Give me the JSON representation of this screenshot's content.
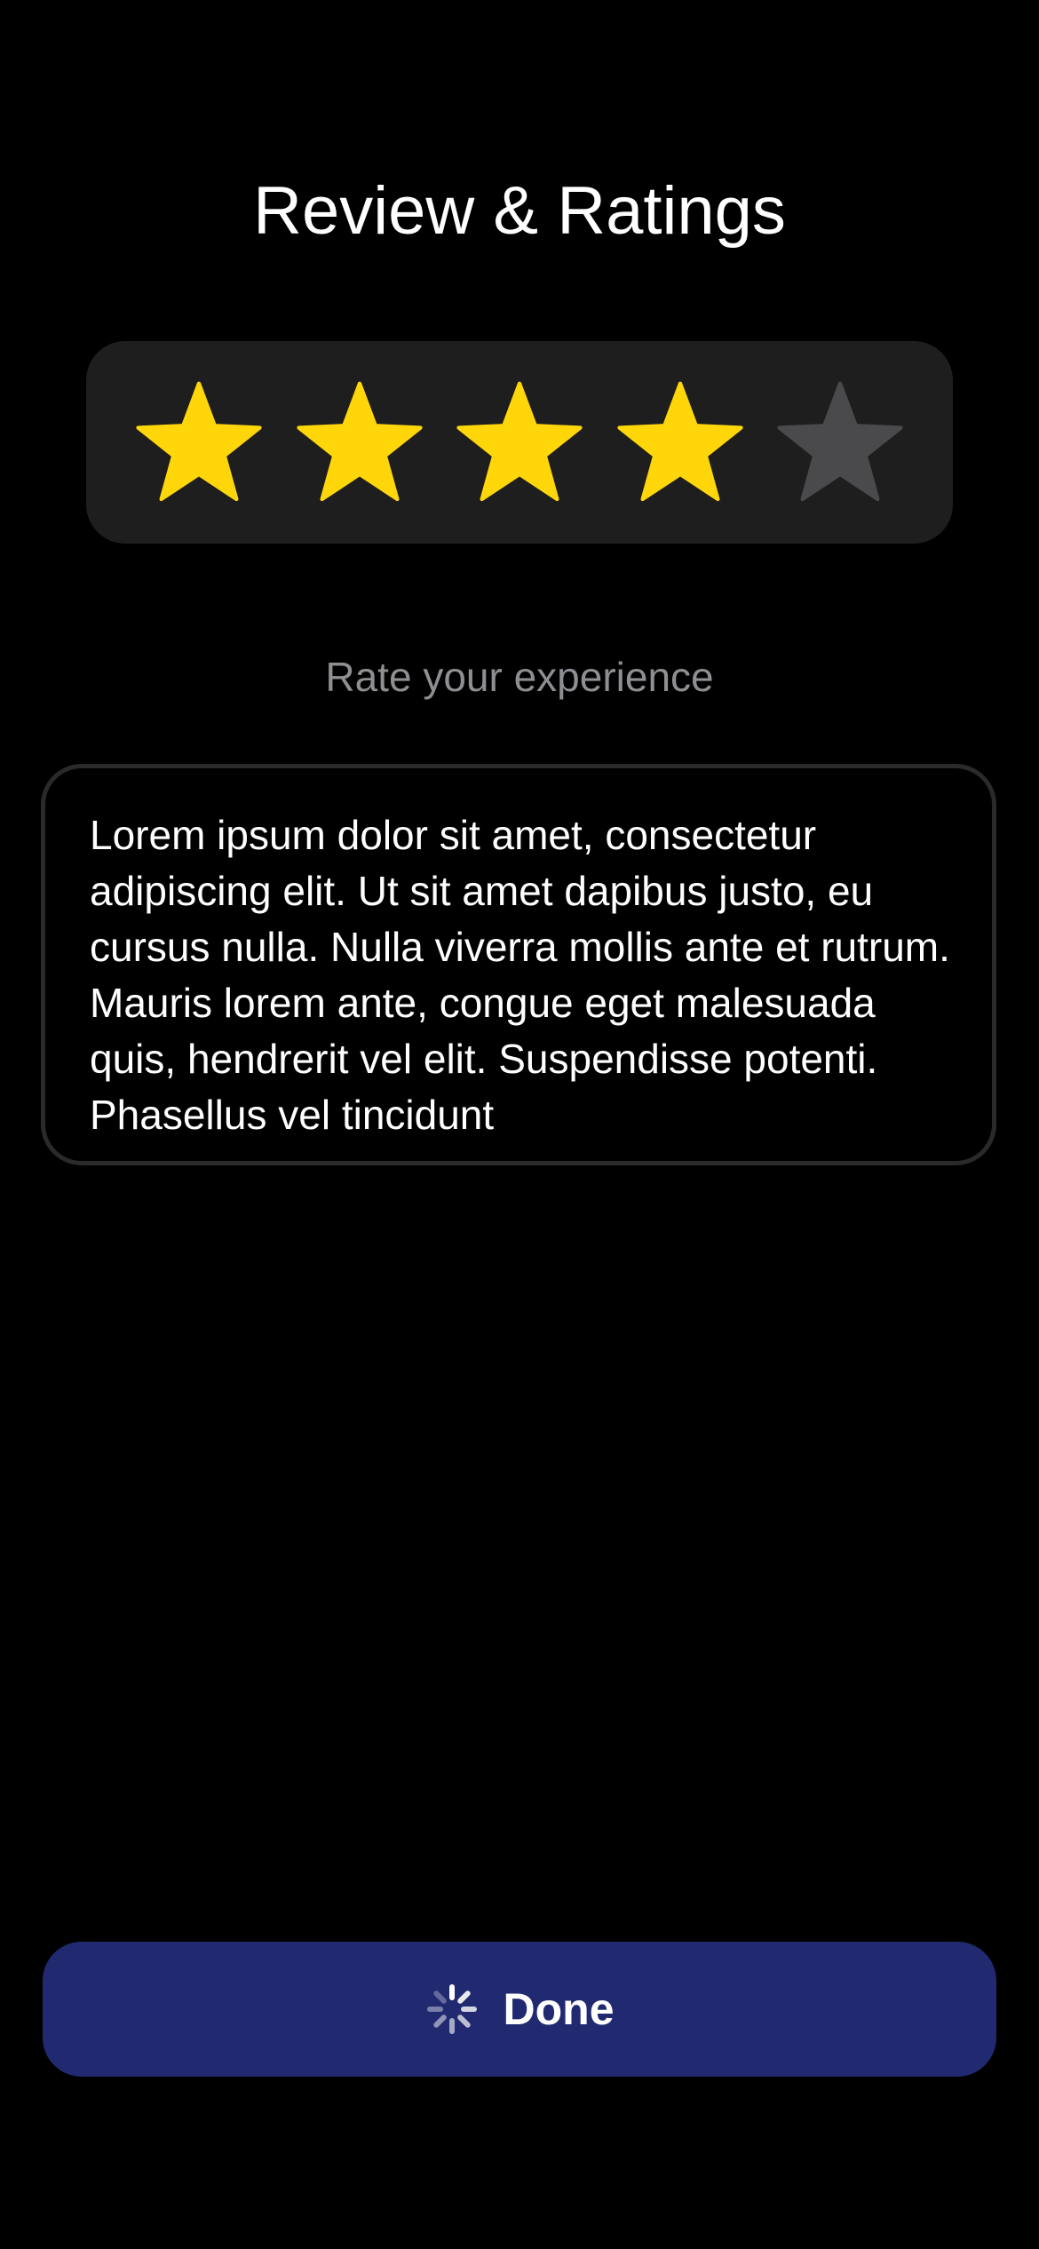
{
  "header": {
    "title": "Review & Ratings"
  },
  "rating": {
    "value": 4,
    "max": 5,
    "filled_color": "#FFD60A",
    "empty_color": "#4A4A4C",
    "card_color": "#1E1E1E"
  },
  "prompt": {
    "text": "Rate your experience"
  },
  "review": {
    "text": "Lorem ipsum dolor sit amet, consectetur adipiscing elit. Ut sit amet dapibus justo, eu cursus nulla. Nulla viverra mollis ante et rutrum. Mauris lorem ante, congue eget malesuada quis, hendrerit vel elit. Suspendisse potenti. Phasellus vel tincidunt"
  },
  "footer": {
    "done_label": "Done",
    "loading_icon": "spinner-icon",
    "button_color": "#212A70"
  }
}
